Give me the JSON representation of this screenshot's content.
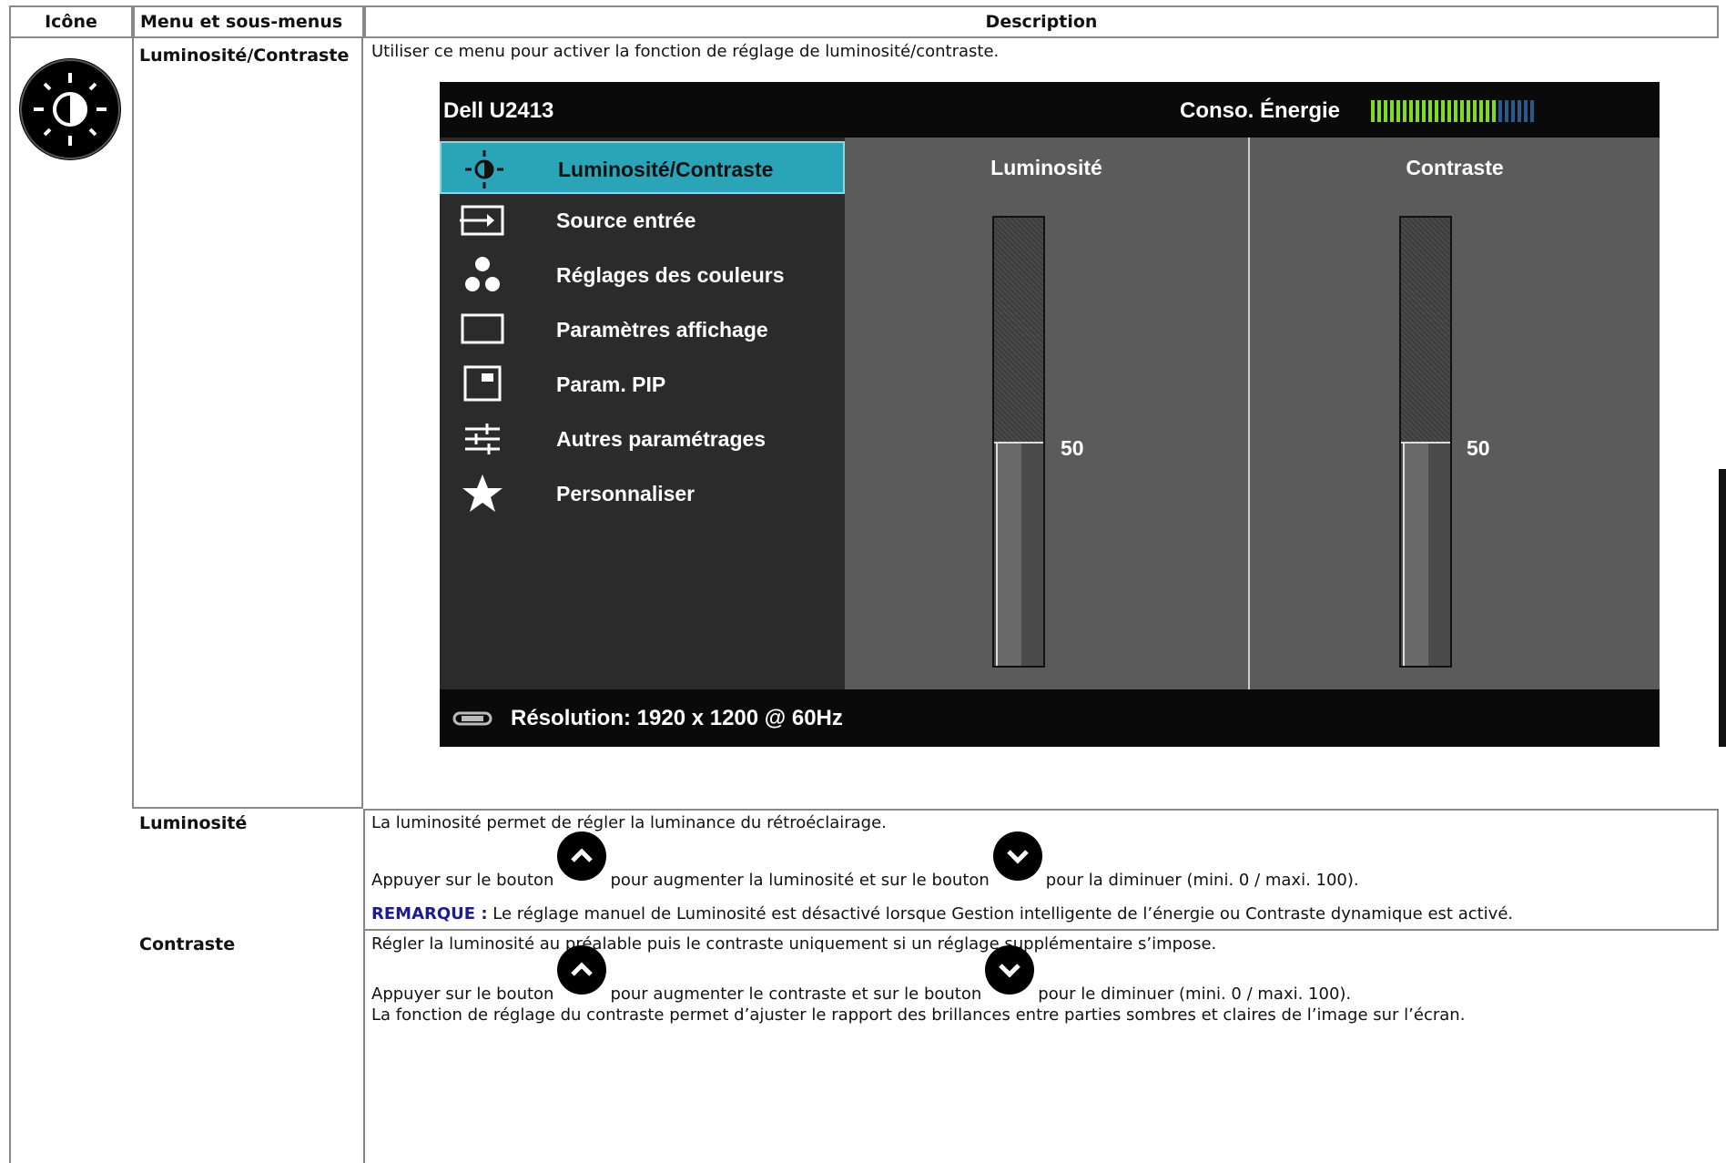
{
  "table": {
    "headers": [
      "Icône",
      "Menu et sous-menus",
      "Description"
    ]
  },
  "rows": {
    "lumcon": {
      "menu": "Luminosité/Contraste",
      "text": "Utiliser ce menu pour activer la fonction de réglage de luminosité/contraste.",
      "icon": "brightness-contrast-icon"
    },
    "luminosite": {
      "menu": "Luminosité",
      "line1": "La luminosité permet de régler la luminance du rétroéclairage.",
      "line2_a": "Appuyer sur le bouton",
      "line2_b": "pour augmenter la luminosité et sur le bouton",
      "line2_c": "pour la diminuer (mini. 0 / maxi. 100).",
      "note_label": "REMARQUE :",
      "note_text": "Le réglage manuel de Luminosité est désactivé lorsque Gestion intelligente de l’énergie ou Contraste dynamique est activé."
    },
    "contraste": {
      "menu": "Contraste",
      "line1": "Régler la luminosité au préalable puis le contraste uniquement si un réglage supplémentaire s’impose.",
      "line2_a": "Appuyer sur le bouton",
      "line2_b": "pour augmenter le contraste et sur le bouton",
      "line2_c": "pour le diminuer (mini. 0 / maxi. 100).",
      "line3": "La fonction de réglage du contraste permet d’ajuster le rapport des brillances entre parties sombres et claires de l’image sur l’écran."
    }
  },
  "osd": {
    "model": "Dell U2413",
    "energy_label": "Conso. Énergie",
    "energy_level": 0.75,
    "energy_color_on": "#7fdc1e",
    "energy_color_off": "#2a5a8a",
    "menu_items": [
      {
        "label": "Luminosité/Contraste",
        "icon": "brightness-icon",
        "selected": true
      },
      {
        "label": "Source entrée",
        "icon": "input-source-icon",
        "selected": false
      },
      {
        "label": "Réglages des couleurs",
        "icon": "color-dots-icon",
        "selected": false
      },
      {
        "label": "Paramètres affichage",
        "icon": "display-rect-icon",
        "selected": false
      },
      {
        "label": "Param. PIP",
        "icon": "pip-icon",
        "selected": false
      },
      {
        "label": "Autres paramétrages",
        "icon": "sliders-icon",
        "selected": false
      },
      {
        "label": "Personnaliser",
        "icon": "star-icon",
        "selected": false
      }
    ],
    "brightness": {
      "title": "Luminosité",
      "value": "50",
      "level": 50,
      "max": 100
    },
    "contrast": {
      "title": "Contraste",
      "value": "50",
      "level": 50,
      "max": 100
    },
    "resolution": "Résolution: 1920 x 1200 @ 60Hz",
    "accent": "#2aa4b7"
  },
  "buttons": {
    "up": "chevron-up-icon",
    "down": "chevron-down-icon"
  }
}
